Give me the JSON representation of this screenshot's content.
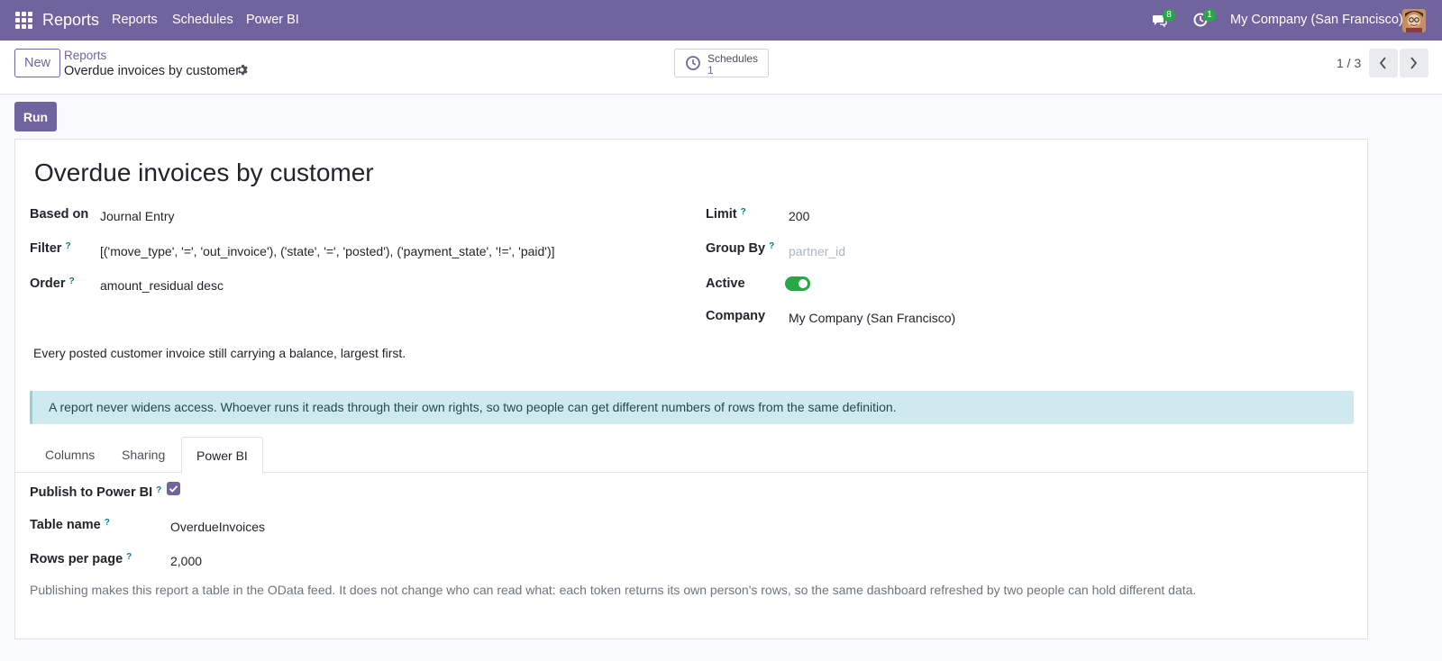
{
  "navbar": {
    "brand": "Reports",
    "menu": [
      "Reports",
      "Schedules",
      "Power BI"
    ],
    "messages_count": "8",
    "activities_count": "1",
    "company": "My Company (San Francisco)"
  },
  "control": {
    "new_label": "New",
    "breadcrumb_parent": "Reports",
    "breadcrumb_current": "Overdue invoices by customer",
    "smart_button_label": "Schedules",
    "smart_button_value": "1",
    "pager": "1 / 3"
  },
  "run_label": "Run",
  "form": {
    "title": "Overdue invoices by customer",
    "based_on_label": "Based on",
    "based_on_value": "Journal Entry",
    "filter_label": "Filter",
    "filter_value": "[('move_type', '=', 'out_invoice'), ('state', '=', 'posted'), ('payment_state', '!=', 'paid')]",
    "order_label": "Order",
    "order_value": "amount_residual desc",
    "limit_label": "Limit",
    "limit_value": "200",
    "group_by_label": "Group By",
    "group_by_placeholder": "partner_id",
    "active_label": "Active",
    "active_value": true,
    "company_label": "Company",
    "company_value": "My Company (San Francisco)",
    "help_mark": "?",
    "description": "Every posted customer invoice still carrying a balance, largest first.",
    "alert": "A report never widens access. Whoever runs it reads through their own rights, so two people can get different numbers of rows from the same definition."
  },
  "tabs": [
    {
      "label": "Columns",
      "active": false
    },
    {
      "label": "Sharing",
      "active": false
    },
    {
      "label": "Power BI",
      "active": true
    }
  ],
  "powerbi": {
    "publish_label": "Publish to Power BI",
    "publish_checked": true,
    "table_name_label": "Table name",
    "table_name_value": "OverdueInvoices",
    "rows_per_page_label": "Rows per page",
    "rows_per_page_value": "2,000",
    "note": "Publishing makes this report a table in the OData feed. It does not change who can read what: each token returns its own person's rows, so the same dashboard refreshed by two people can hold different data."
  },
  "colors": {
    "brand": "#71639e",
    "success": "#28a745",
    "info_bg": "#cfeaee",
    "help": "#017e84"
  },
  "icons": [
    "apps-icon",
    "chat-icon",
    "activity-clock-icon",
    "gear-icon",
    "clock-icon",
    "chevron-left-icon",
    "chevron-right-icon",
    "checkmark-icon"
  ]
}
